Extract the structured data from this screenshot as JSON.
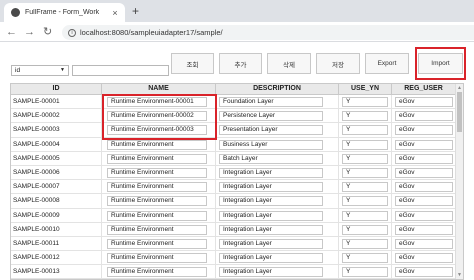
{
  "browser": {
    "tab_title": "FullFrame - Form_Work",
    "tab_close": "×",
    "new_tab": "+",
    "back": "←",
    "forward": "→",
    "reload": "↻",
    "info": "i",
    "url": "localhost:8080/sampleuiadapter17/sample/"
  },
  "toolbar": {
    "search_label": "조회",
    "add_label": "추가",
    "delete_label": "삭제",
    "save_label": "저장",
    "export_label": "Export",
    "import_label": "Import"
  },
  "search": {
    "select_value": "id",
    "input_value": ""
  },
  "grid": {
    "columns": [
      "ID",
      "NAME",
      "DESCRIPTION",
      "USE_YN",
      "REG_USER"
    ],
    "rows": [
      {
        "id": "SAMPLE-00001",
        "name": "Runtime Environment-00001",
        "desc": "Foundation Layer",
        "use": "Y",
        "reg": "eGov"
      },
      {
        "id": "SAMPLE-00002",
        "name": "Runtime Environment-00002",
        "desc": "Persistence Layer",
        "use": "Y",
        "reg": "eGov"
      },
      {
        "id": "SAMPLE-00003",
        "name": "Runtime Environment-00003",
        "desc": "Presentation Layer",
        "use": "Y",
        "reg": "eGov"
      },
      {
        "id": "SAMPLE-00004",
        "name": "Runtime Environment",
        "desc": "Business Layer",
        "use": "Y",
        "reg": "eGov"
      },
      {
        "id": "SAMPLE-00005",
        "name": "Runtime Environment",
        "desc": "Batch Layer",
        "use": "Y",
        "reg": "eGov"
      },
      {
        "id": "SAMPLE-00006",
        "name": "Runtime Environment",
        "desc": "Integration Layer",
        "use": "Y",
        "reg": "eGov"
      },
      {
        "id": "SAMPLE-00007",
        "name": "Runtime Environment",
        "desc": "Integration Layer",
        "use": "Y",
        "reg": "eGov"
      },
      {
        "id": "SAMPLE-00008",
        "name": "Runtime Environment",
        "desc": "Integration Layer",
        "use": "Y",
        "reg": "eGov"
      },
      {
        "id": "SAMPLE-00009",
        "name": "Runtime Environment",
        "desc": "Integration Layer",
        "use": "Y",
        "reg": "eGov"
      },
      {
        "id": "SAMPLE-00010",
        "name": "Runtime Environment",
        "desc": "Integration Layer",
        "use": "Y",
        "reg": "eGov"
      },
      {
        "id": "SAMPLE-00011",
        "name": "Runtime Environment",
        "desc": "Integration Layer",
        "use": "Y",
        "reg": "eGov"
      },
      {
        "id": "SAMPLE-00012",
        "name": "Runtime Environment",
        "desc": "Integration Layer",
        "use": "Y",
        "reg": "eGov"
      },
      {
        "id": "SAMPLE-00013",
        "name": "Runtime Environment",
        "desc": "Integration Layer",
        "use": "Y",
        "reg": "eGov"
      },
      {
        "id": "SAMPLE-00014",
        "name": "Runtime Environment",
        "desc": "Integration Layer",
        "use": "Y",
        "reg": "eGov"
      }
    ]
  },
  "highlight_color": "#d9232a"
}
